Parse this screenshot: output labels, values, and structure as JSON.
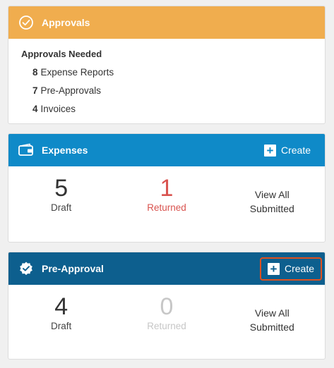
{
  "approvals": {
    "title": "Approvals",
    "icon": "check-circle-icon",
    "needed_title": "Approvals Needed",
    "items": [
      {
        "count": "8",
        "label": "Expense Reports"
      },
      {
        "count": "7",
        "label": "Pre-Approvals"
      },
      {
        "count": "4",
        "label": "Invoices"
      }
    ],
    "color": "#f0ad4e"
  },
  "expenses": {
    "title": "Expenses",
    "icon": "wallet-icon",
    "create_label": "Create",
    "draft_count": "5",
    "draft_label": "Draft",
    "returned_count": "1",
    "returned_label": "Returned",
    "view_all_label": "View All Submitted",
    "color": "#0f8ac8",
    "returned_color": "#d9534f"
  },
  "preapproval": {
    "title": "Pre-Approval",
    "icon": "check-badge-icon",
    "create_label": "Create",
    "draft_count": "4",
    "draft_label": "Draft",
    "returned_count": "0",
    "returned_label": "Returned",
    "view_all_label": "View All Submitted",
    "color": "#0d5f8e",
    "highlight_color": "#e0501e"
  }
}
